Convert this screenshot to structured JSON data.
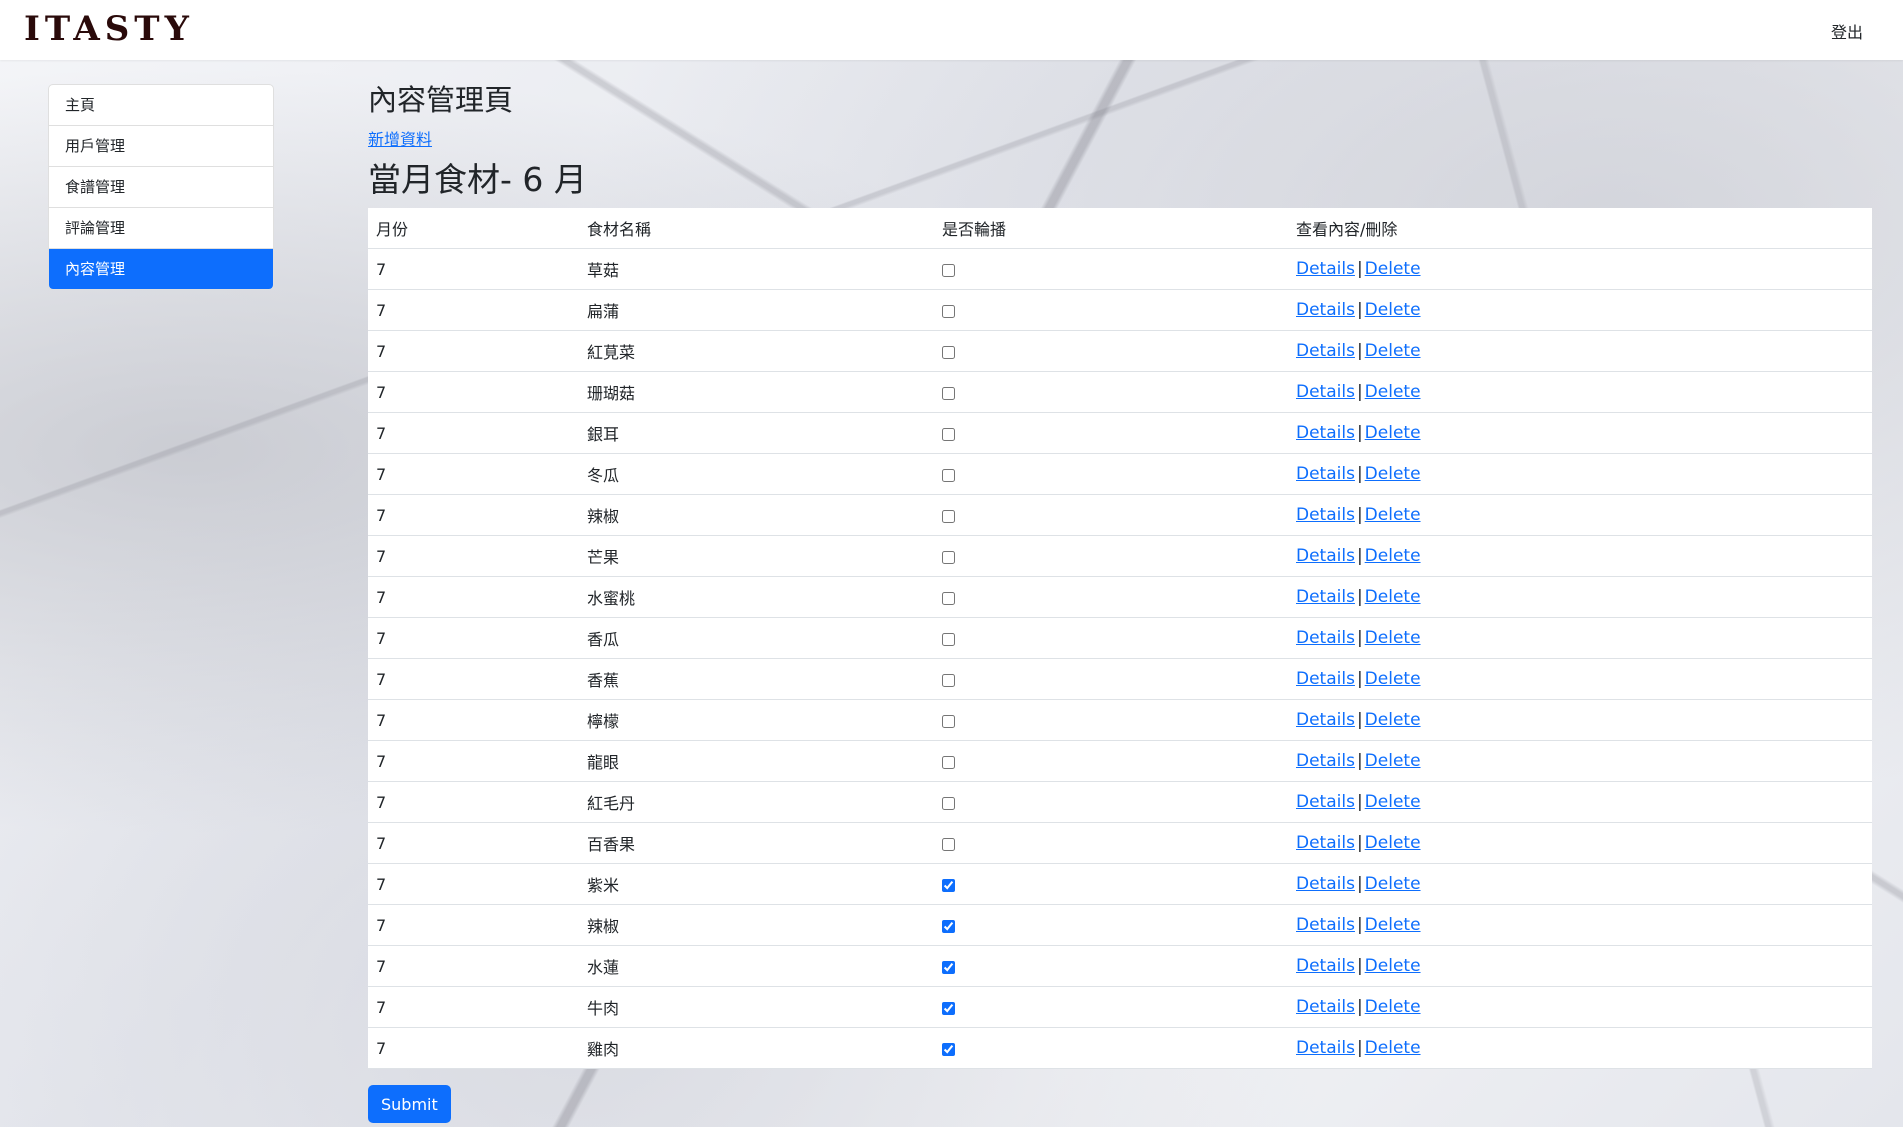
{
  "header": {
    "brand": "ITASTY",
    "logout_label": "登出"
  },
  "sidebar": {
    "items": [
      {
        "label": "主頁",
        "active": false
      },
      {
        "label": "用戶管理",
        "active": false
      },
      {
        "label": "食譜管理",
        "active": false
      },
      {
        "label": "評論管理",
        "active": false
      },
      {
        "label": "內容管理",
        "active": true
      }
    ]
  },
  "main": {
    "page_title": "內容管理頁",
    "add_link": "新增資料",
    "section_title": "當月食材- 6 月",
    "columns": [
      "月份",
      "食材名稱",
      "是否輪播",
      "查看內容/刪除"
    ],
    "details_label": "Details",
    "delete_label": "Delete",
    "separator": "|",
    "rows": [
      {
        "month": "7",
        "name": "草菇",
        "rotate": false
      },
      {
        "month": "7",
        "name": "扁蒲",
        "rotate": false
      },
      {
        "month": "7",
        "name": "紅莧菜",
        "rotate": false
      },
      {
        "month": "7",
        "name": "珊瑚菇",
        "rotate": false
      },
      {
        "month": "7",
        "name": "銀耳",
        "rotate": false
      },
      {
        "month": "7",
        "name": "冬瓜",
        "rotate": false
      },
      {
        "month": "7",
        "name": "辣椒",
        "rotate": false
      },
      {
        "month": "7",
        "name": "芒果",
        "rotate": false
      },
      {
        "month": "7",
        "name": "水蜜桃",
        "rotate": false
      },
      {
        "month": "7",
        "name": "香瓜",
        "rotate": false
      },
      {
        "month": "7",
        "name": "香蕉",
        "rotate": false
      },
      {
        "month": "7",
        "name": "檸檬",
        "rotate": false
      },
      {
        "month": "7",
        "name": "龍眼",
        "rotate": false
      },
      {
        "month": "7",
        "name": "紅毛丹",
        "rotate": false
      },
      {
        "month": "7",
        "name": "百香果",
        "rotate": false
      },
      {
        "month": "7",
        "name": "紫米",
        "rotate": true
      },
      {
        "month": "7",
        "name": "辣椒",
        "rotate": true
      },
      {
        "month": "7",
        "name": "水蓮",
        "rotate": true
      },
      {
        "month": "7",
        "name": "牛肉",
        "rotate": true
      },
      {
        "month": "7",
        "name": "雞肉",
        "rotate": true
      }
    ],
    "submit_label": "Submit"
  },
  "colors": {
    "accent": "#0d6efd",
    "brand": "#2a0a0a"
  }
}
